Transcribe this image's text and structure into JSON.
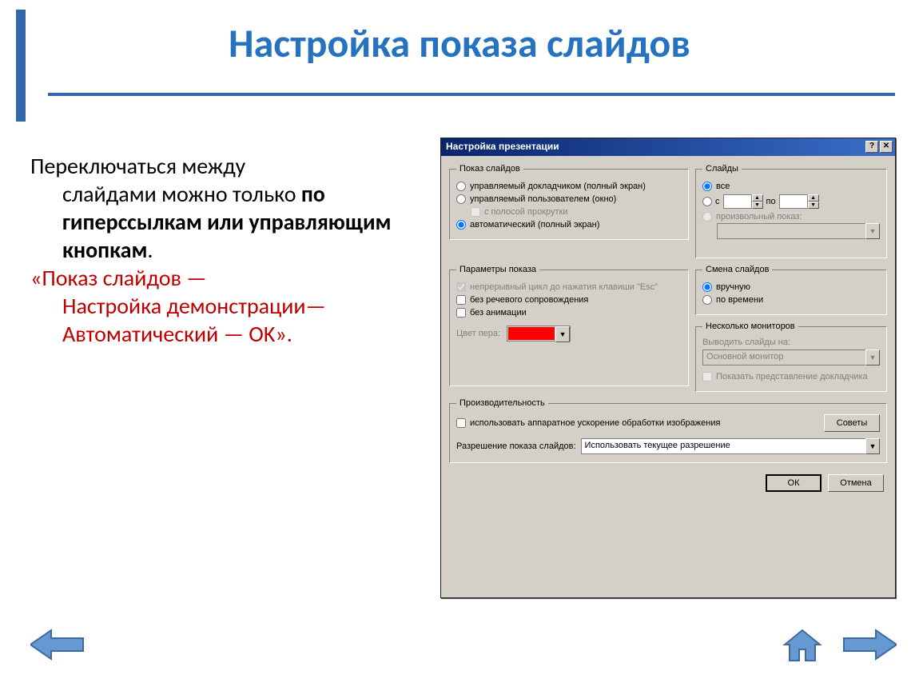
{
  "slide": {
    "title": "Настройка показа слайдов",
    "p1_lead": "Переключаться между",
    "p1_rest": "слайдами можно только ",
    "p1_bold": "по гиперссылкам или управляющим кнопкам",
    "p1_period": ".",
    "p2_a": "«Показ слайдов —",
    "p2_b": "Настройка демонстрации—Автоматический — OK»."
  },
  "dialog": {
    "title": "Настройка презентации",
    "help_btn": "?",
    "close_btn": "✕",
    "group_show": {
      "legend": "Показ слайдов",
      "r1": "управляемый докладчиком (полный экран)",
      "r2": "управляемый пользователем (окно)",
      "chk_scroll": "с полосой прокрутки",
      "r3": "автоматический (полный экран)"
    },
    "group_slides": {
      "legend": "Слайды",
      "r_all": "все",
      "label_from": "с",
      "label_to": "по",
      "r_custom": "произвольный показ:"
    },
    "group_params": {
      "legend": "Параметры показа",
      "c1": "непрерывный цикл до нажатия клавиши \"Esc\"",
      "c2": "без речевого сопровождения",
      "c3": "без анимации",
      "pen_label": "Цвет пера:"
    },
    "group_change": {
      "legend": "Смена слайдов",
      "r1": "вручную",
      "r2": "по времени"
    },
    "group_monitors": {
      "legend": "Несколько мониторов",
      "out_label": "Выводить слайды на:",
      "out_value": "Основной монитор",
      "presenter": "Показать представление докладчика"
    },
    "group_perf": {
      "legend": "Производительность",
      "hw": "использовать аппаратное ускорение обработки изображения",
      "tips_btn": "Советы",
      "res_label": "Разрешение показа слайдов:",
      "res_value": "Использовать текущее разрешение"
    },
    "ok": "ОК",
    "cancel": "Отмена"
  }
}
